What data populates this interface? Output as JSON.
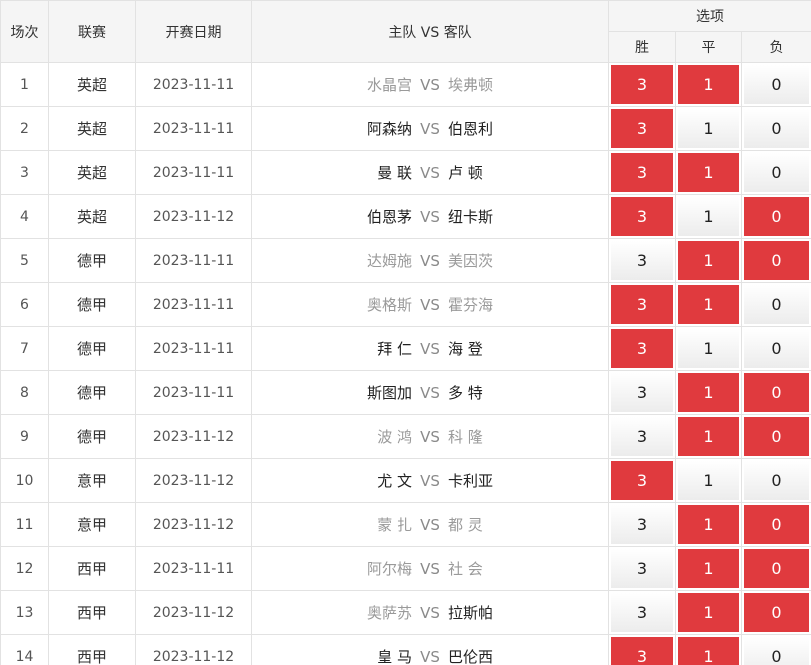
{
  "header": {
    "num": "场次",
    "league": "联赛",
    "date": "开赛日期",
    "home": "主队",
    "vs": "VS",
    "away": "客队",
    "options": "选项",
    "win": "胜",
    "draw": "平",
    "lose": "负"
  },
  "colors": {
    "selected": "#e03a3e",
    "unselected": "#f2f2f2"
  },
  "rows": [
    {
      "num": "1",
      "league": "英超",
      "date": "2023-11-11",
      "home": "水晶宫",
      "away": "埃弗顿",
      "home_dim": true,
      "away_dim": true,
      "win": "3",
      "draw": "1",
      "lose": "0",
      "sel": [
        true,
        true,
        false
      ]
    },
    {
      "num": "2",
      "league": "英超",
      "date": "2023-11-11",
      "home": "阿森纳",
      "away": "伯恩利",
      "home_dim": false,
      "away_dim": false,
      "win": "3",
      "draw": "1",
      "lose": "0",
      "sel": [
        true,
        false,
        false
      ]
    },
    {
      "num": "3",
      "league": "英超",
      "date": "2023-11-11",
      "home": "曼 联",
      "away": "卢 顿",
      "home_dim": false,
      "away_dim": false,
      "win": "3",
      "draw": "1",
      "lose": "0",
      "sel": [
        true,
        true,
        false
      ]
    },
    {
      "num": "4",
      "league": "英超",
      "date": "2023-11-12",
      "home": "伯恩茅",
      "away": "纽卡斯",
      "home_dim": false,
      "away_dim": false,
      "win": "3",
      "draw": "1",
      "lose": "0",
      "sel": [
        true,
        false,
        true
      ]
    },
    {
      "num": "5",
      "league": "德甲",
      "date": "2023-11-11",
      "home": "达姆施",
      "away": "美因茨",
      "home_dim": true,
      "away_dim": true,
      "win": "3",
      "draw": "1",
      "lose": "0",
      "sel": [
        false,
        true,
        true
      ]
    },
    {
      "num": "6",
      "league": "德甲",
      "date": "2023-11-11",
      "home": "奥格斯",
      "away": "霍芬海",
      "home_dim": true,
      "away_dim": true,
      "win": "3",
      "draw": "1",
      "lose": "0",
      "sel": [
        true,
        true,
        false
      ]
    },
    {
      "num": "7",
      "league": "德甲",
      "date": "2023-11-11",
      "home": "拜 仁",
      "away": "海 登",
      "home_dim": false,
      "away_dim": false,
      "win": "3",
      "draw": "1",
      "lose": "0",
      "sel": [
        true,
        false,
        false
      ]
    },
    {
      "num": "8",
      "league": "德甲",
      "date": "2023-11-11",
      "home": "斯图加",
      "away": "多 特",
      "home_dim": false,
      "away_dim": false,
      "win": "3",
      "draw": "1",
      "lose": "0",
      "sel": [
        false,
        true,
        true
      ]
    },
    {
      "num": "9",
      "league": "德甲",
      "date": "2023-11-12",
      "home": "波 鸿",
      "away": "科 隆",
      "home_dim": true,
      "away_dim": true,
      "win": "3",
      "draw": "1",
      "lose": "0",
      "sel": [
        false,
        true,
        true
      ]
    },
    {
      "num": "10",
      "league": "意甲",
      "date": "2023-11-12",
      "home": "尤 文",
      "away": "卡利亚",
      "home_dim": false,
      "away_dim": false,
      "win": "3",
      "draw": "1",
      "lose": "0",
      "sel": [
        true,
        false,
        false
      ]
    },
    {
      "num": "11",
      "league": "意甲",
      "date": "2023-11-12",
      "home": "蒙 扎",
      "away": "都 灵",
      "home_dim": true,
      "away_dim": true,
      "win": "3",
      "draw": "1",
      "lose": "0",
      "sel": [
        false,
        true,
        true
      ]
    },
    {
      "num": "12",
      "league": "西甲",
      "date": "2023-11-11",
      "home": "阿尔梅",
      "away": "社 会",
      "home_dim": true,
      "away_dim": true,
      "win": "3",
      "draw": "1",
      "lose": "0",
      "sel": [
        false,
        true,
        true
      ]
    },
    {
      "num": "13",
      "league": "西甲",
      "date": "2023-11-12",
      "home": "奥萨苏",
      "away": "拉斯帕",
      "home_dim": true,
      "away_dim": false,
      "win": "3",
      "draw": "1",
      "lose": "0",
      "sel": [
        false,
        true,
        true
      ]
    },
    {
      "num": "14",
      "league": "西甲",
      "date": "2023-11-12",
      "home": "皇 马",
      "away": "巴伦西",
      "home_dim": false,
      "away_dim": false,
      "win": "3",
      "draw": "1",
      "lose": "0",
      "sel": [
        true,
        true,
        false
      ]
    }
  ]
}
